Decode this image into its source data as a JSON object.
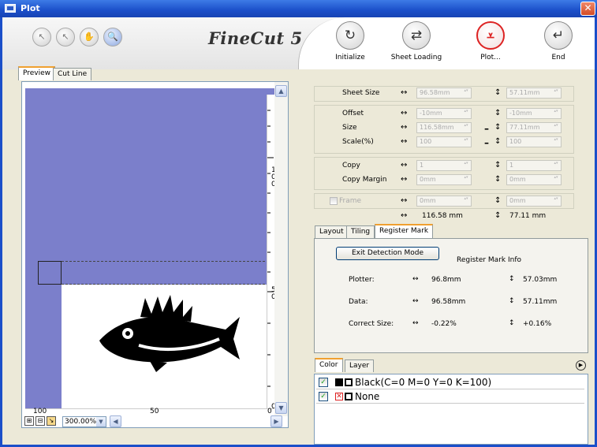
{
  "window": {
    "title": "Plot",
    "close_glyph": "✕"
  },
  "app_logo": "FineCut 5",
  "toolbar": {
    "tools": [
      {
        "name": "select-arrow-icon",
        "glyph": "↖"
      },
      {
        "name": "node-arrow-icon",
        "glyph": "↖"
      },
      {
        "name": "hand-icon",
        "glyph": "✋"
      },
      {
        "name": "zoom-icon",
        "glyph": "🔍"
      }
    ]
  },
  "actions": [
    {
      "label": "Initialize",
      "glyph": "↻"
    },
    {
      "label": "Sheet Loading",
      "glyph": "⇄"
    },
    {
      "label": "Plot...",
      "glyph": "⩡"
    },
    {
      "label": "End",
      "glyph": "↵"
    }
  ],
  "preview_tabs": [
    "Preview",
    "Cut Line"
  ],
  "ruler": {
    "v_labels": [
      "1",
      "0",
      "0",
      "5",
      "0",
      "0"
    ],
    "h_labels": [
      "100",
      "50",
      "0"
    ]
  },
  "zoom": {
    "value": "300.00%"
  },
  "settings": {
    "sheet_size": {
      "label": "Sheet Size",
      "w": "96.58mm",
      "h": "57.11mm"
    },
    "offset": {
      "label": "Offset",
      "w": "-10mm",
      "h": "-10mm"
    },
    "size": {
      "label": "Size",
      "w": "116.58mm",
      "h": "77.11mm"
    },
    "scale": {
      "label": "Scale(%)",
      "w": "100",
      "h": "100"
    },
    "copy": {
      "label": "Copy",
      "w": "1",
      "h": "1"
    },
    "copy_margin": {
      "label": "Copy Margin",
      "w": "0mm",
      "h": "0mm"
    },
    "frame": {
      "label": "Frame",
      "w": "0mm",
      "h": "0mm"
    },
    "total": {
      "w": "116.58 mm",
      "h": "77.11 mm"
    }
  },
  "mid_tabs": [
    "Layout",
    "Tiling",
    "Register Mark"
  ],
  "register_mark": {
    "exit_button": "Exit Detection Mode",
    "info_title": "Register Mark Info",
    "rows": [
      {
        "label": "Plotter:",
        "w": "96.8mm",
        "h": "57.03mm"
      },
      {
        "label": "Data:",
        "w": "96.58mm",
        "h": "57.11mm"
      },
      {
        "label": "Correct Size:",
        "w": "-0.22%",
        "h": "+0.16%"
      }
    ]
  },
  "bottom_tabs": [
    "Color",
    "Layer"
  ],
  "colors": [
    {
      "name": "Black(C=0 M=0 Y=0 K=100)",
      "checked": true
    },
    {
      "name": "None",
      "checked": true
    }
  ],
  "accent": {
    "canvas": "#7b7fcb",
    "titlebar": "#1b4fc9",
    "plot_red": "#d22222"
  }
}
